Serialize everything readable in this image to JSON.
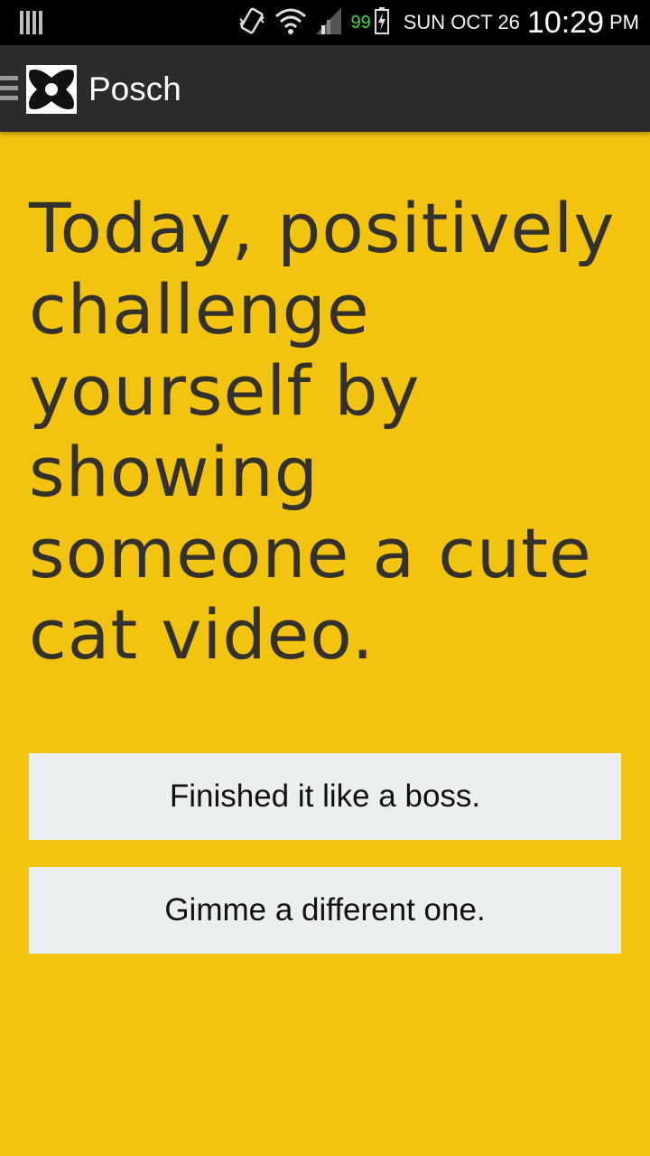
{
  "status_bar": {
    "battery_percent": "99",
    "date": "SUN OCT 26",
    "time": "10:29",
    "ampm": "PM",
    "icons": [
      "notification-bars-icon",
      "vibrate-icon",
      "wifi-icon",
      "signal-icon",
      "battery-charging-icon"
    ]
  },
  "action_bar": {
    "title": "Posch",
    "icons": [
      "menu-icon",
      "app-logo-icon"
    ]
  },
  "main": {
    "challenge_text": "Today, positively challenge yourself by showing someone a cute cat video.",
    "buttons": {
      "finished": "Finished it like a boss.",
      "different": "Gimme a different one."
    }
  },
  "colors": {
    "background": "#F2C40F",
    "action_bar": "#2B2B2B",
    "text": "#333129",
    "button_bg": "#ECEFF0",
    "battery_text": "#39D84A"
  }
}
